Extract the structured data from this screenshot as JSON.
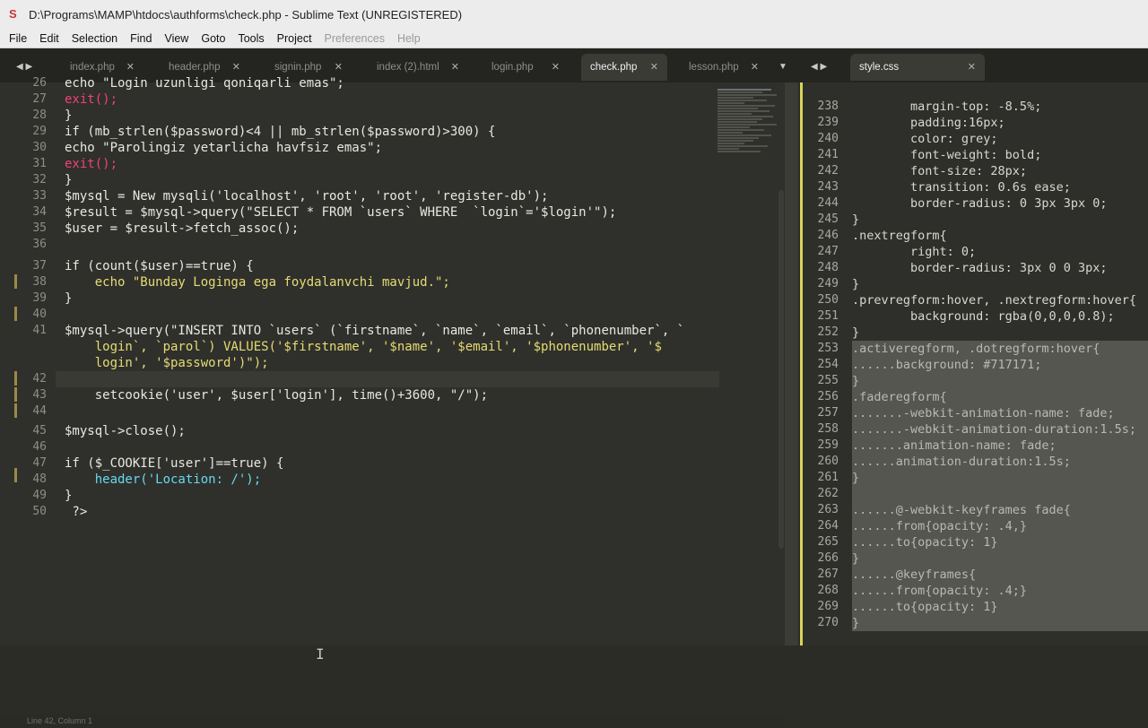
{
  "window": {
    "title": "D:\\Programs\\MAMP\\htdocs\\authforms\\check.php - Sublime Text (UNREGISTERED)"
  },
  "menu": [
    "File",
    "Edit",
    "Selection",
    "Find",
    "View",
    "Goto",
    "Tools",
    "Project",
    "Preferences",
    "Help"
  ],
  "tabs_left": [
    {
      "label": "index.php"
    },
    {
      "label": "header.php"
    },
    {
      "label": "signin.php"
    },
    {
      "label": "index (2).html"
    },
    {
      "label": "login.php"
    },
    {
      "label": "check.php",
      "active": true
    },
    {
      "label": "lesson.php"
    }
  ],
  "tabs_right": [
    {
      "label": "style.css",
      "active": true
    }
  ],
  "left_lines": [
    {
      "n": "26",
      "t": "echo \"Login uzunligi qoniqarli emas\";"
    },
    {
      "n": "27",
      "t": "exit();"
    },
    {
      "n": "28",
      "t": "}"
    },
    {
      "n": "29",
      "t": "if (mb_strlen($password)<4 || mb_strlen($password)>300) {"
    },
    {
      "n": "30",
      "t": "echo \"Parolingiz yetarlicha havfsiz emas\";"
    },
    {
      "n": "31",
      "t": "exit();"
    },
    {
      "n": "32",
      "t": "}"
    },
    {
      "n": "33",
      "t": "$mysql = New mysqli('localhost', 'root', 'root', 'register-db');"
    },
    {
      "n": "34",
      "t": "$result = $mysql->query(\"SELECT * FROM `users` WHERE  `login`='$login'\");"
    },
    {
      "n": "35",
      "t": "$user = $result->fetch_assoc();"
    },
    {
      "n": "36",
      "t": ""
    },
    {
      "n": "37",
      "t": "if (count($user)==true) {"
    },
    {
      "n": "38",
      "t": "    echo \"Bunday Loginga ega foydalanvchi mavjud.\";"
    },
    {
      "n": "39",
      "t": "}"
    },
    {
      "n": "40",
      "t": ""
    },
    {
      "n": "41",
      "t": "$mysql->query(\"INSERT INTO `users` (`firstname`, `name`, `email`, `phonenumber`, `"
    },
    {
      "n": "",
      "t": "    login`, `parol`) VALUES('$firstname', '$name', '$email', '$phonenumber', '$"
    },
    {
      "n": "",
      "t": "    login', '$password')\");"
    },
    {
      "n": "42",
      "t": ""
    },
    {
      "n": "43",
      "t": "    setcookie('user', $user['login'], time()+3600, \"/\");"
    },
    {
      "n": "44",
      "t": ""
    },
    {
      "n": "45",
      "t": "$mysql->close();"
    },
    {
      "n": "46",
      "t": ""
    },
    {
      "n": "47",
      "t": "if ($_COOKIE['user']==true) {"
    },
    {
      "n": "48",
      "t": "    header('Location: /');"
    },
    {
      "n": "49",
      "t": "}"
    },
    {
      "n": "50",
      "t": " ?>"
    }
  ],
  "right_lines": [
    {
      "n": "238",
      "t": "        margin-top: -8.5%;"
    },
    {
      "n": "239",
      "t": "        padding:16px;"
    },
    {
      "n": "240",
      "t": "        color: grey;"
    },
    {
      "n": "241",
      "t": "        font-weight: bold;"
    },
    {
      "n": "242",
      "t": "        font-size: 28px;"
    },
    {
      "n": "243",
      "t": "        transition: 0.6s ease;"
    },
    {
      "n": "244",
      "t": "        border-radius: 0 3px 3px 0;"
    },
    {
      "n": "245",
      "t": "}"
    },
    {
      "n": "246",
      "t": ".nextregform{"
    },
    {
      "n": "247",
      "t": "        right: 0;"
    },
    {
      "n": "248",
      "t": "        border-radius: 3px 0 0 3px;"
    },
    {
      "n": "249",
      "t": "}"
    },
    {
      "n": "250",
      "t": ".prevregform:hover, .nextregform:hover{"
    },
    {
      "n": "251",
      "t": "        background: rgba(0,0,0,0.8);"
    },
    {
      "n": "252",
      "t": "}"
    },
    {
      "n": "253",
      "t": ".activeregform, .dotregform:hover{",
      "sel": true
    },
    {
      "n": "254",
      "t": "......background: #717171;",
      "sel": true
    },
    {
      "n": "255",
      "t": "}",
      "sel": true
    },
    {
      "n": "256",
      "t": ".faderegform{",
      "sel": true
    },
    {
      "n": "257",
      "t": ".......-webkit-animation-name: fade;",
      "sel": true
    },
    {
      "n": "258",
      "t": ".......-webkit-animation-duration:1.5s;",
      "sel": true
    },
    {
      "n": "259",
      "t": ".......animation-name: fade;",
      "sel": true
    },
    {
      "n": "260",
      "t": "......animation-duration:1.5s;",
      "sel": true
    },
    {
      "n": "261",
      "t": "}",
      "sel": true
    },
    {
      "n": "262",
      "t": "",
      "sel": true
    },
    {
      "n": "263",
      "t": "......@-webkit-keyframes fade{",
      "sel": true
    },
    {
      "n": "264",
      "t": "......from{opacity: .4,}",
      "sel": true
    },
    {
      "n": "265",
      "t": "......to{opacity: 1}",
      "sel": true
    },
    {
      "n": "266",
      "t": "}",
      "sel": true
    },
    {
      "n": "267",
      "t": "......@keyframes{",
      "sel": true
    },
    {
      "n": "268",
      "t": "......from{opacity: .4;}",
      "sel": true
    },
    {
      "n": "269",
      "t": "......to{opacity: 1}",
      "sel": true
    },
    {
      "n": "270",
      "t": "}",
      "sel": true
    }
  ],
  "statusbar": "Line 42, Column 1"
}
